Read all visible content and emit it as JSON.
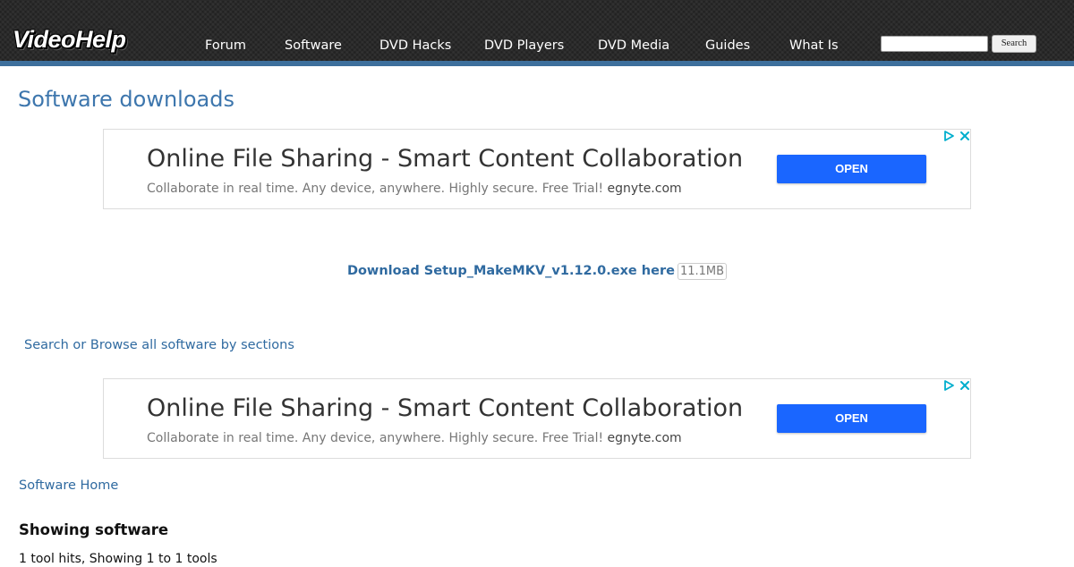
{
  "header": {
    "logo": "VideoHelp",
    "nav": [
      "Forum",
      "Software",
      "DVD Hacks",
      "DVD Players",
      "DVD Media",
      "Guides",
      "What Is"
    ],
    "search": {
      "value": "",
      "placeholder": "",
      "button_label": "Search"
    }
  },
  "main": {
    "title": "Software downloads",
    "ads": [
      {
        "headline": "Online File Sharing - Smart Content Collaboration",
        "description": "Collaborate in real time. Any device, anywhere. Highly secure. Free Trial!",
        "domain": "egnyte.com",
        "cta": "OPEN",
        "icons": [
          "adchoices-icon",
          "close-icon"
        ]
      },
      {
        "headline": "Online File Sharing - Smart Content Collaboration",
        "description": "Collaborate in real time. Any device, anywhere. Highly secure. Free Trial!",
        "domain": "egnyte.com",
        "cta": "OPEN",
        "icons": [
          "adchoices-icon",
          "close-icon"
        ]
      }
    ],
    "download": {
      "link_text": "Download Setup_MakeMKV_v1.12.0.exe here",
      "size": "11.1MB"
    },
    "browse_link": "Search or Browse all software by sections",
    "software_home_link": "Software Home",
    "showing_heading": "Showing software",
    "hits_text": "1 tool hits, Showing 1 to 1 tools"
  },
  "colors": {
    "header_bg": "#222222",
    "header_stripe": "#3d6f9c",
    "title": "#3d76ad",
    "link": "#2f6aa0",
    "ad_button": "#1a66ff",
    "adchoices": "#00aecd"
  }
}
